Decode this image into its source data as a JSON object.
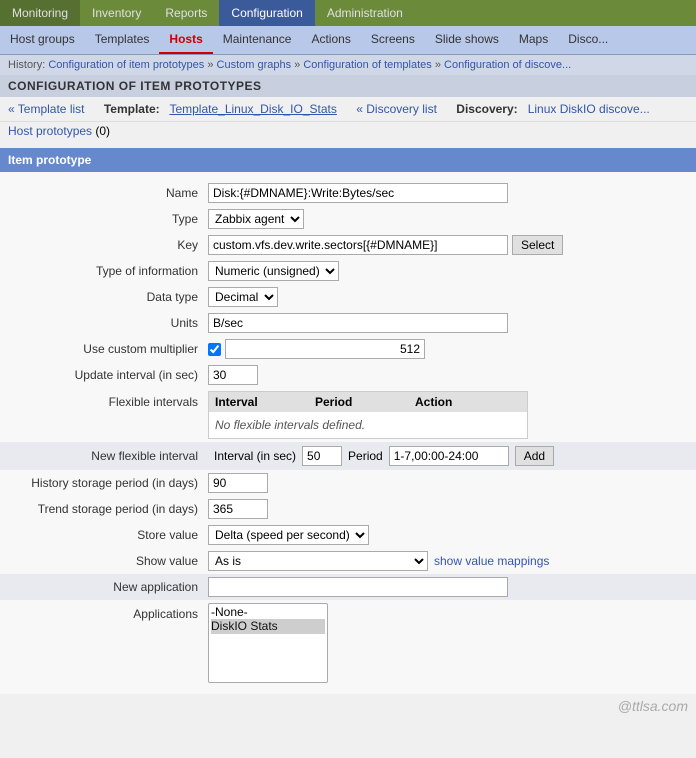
{
  "topnav": {
    "items": [
      {
        "label": "Monitoring",
        "active": false
      },
      {
        "label": "Inventory",
        "active": false
      },
      {
        "label": "Reports",
        "active": false
      },
      {
        "label": "Configuration",
        "active": true
      },
      {
        "label": "Administration",
        "active": false
      }
    ]
  },
  "secondnav": {
    "items": [
      {
        "label": "Host groups",
        "active": false
      },
      {
        "label": "Templates",
        "active": false
      },
      {
        "label": "Hosts",
        "active": true
      },
      {
        "label": "Maintenance",
        "active": false
      },
      {
        "label": "Actions",
        "active": false
      },
      {
        "label": "Screens",
        "active": false
      },
      {
        "label": "Slide shows",
        "active": false
      },
      {
        "label": "Maps",
        "active": false
      },
      {
        "label": "Disco...",
        "active": false
      }
    ]
  },
  "breadcrumb": {
    "text": "History:",
    "items": [
      {
        "label": "Configuration of item prototypes"
      },
      {
        "label": "Custom graphs"
      },
      {
        "label": "Configuration of templates"
      },
      {
        "label": "Configuration of discove..."
      }
    ]
  },
  "page_title": "CONFIGURATION OF ITEM PROTOTYPES",
  "template_line": {
    "template_list_label": "« Template list",
    "template_prefix": "Template:",
    "template_name": "Template_Linux_Disk_IO_Stats",
    "discovery_list_label": "« Discovery list",
    "discovery_prefix": "Discovery:",
    "discovery_name": "Linux DiskIO discove...",
    "host_proto_label": "Host prototypes",
    "host_proto_count": "(0)"
  },
  "section": {
    "title": "Item prototype"
  },
  "form": {
    "name_label": "Name",
    "name_value": "Disk:{#DMNAME}:Write:Bytes/sec",
    "type_label": "Type",
    "type_value": "Zabbix agent",
    "key_label": "Key",
    "key_value": "custom.vfs.dev.write.sectors[{#DMNAME}]",
    "key_btn": "Select",
    "type_info_label": "Type of information",
    "type_info_value": "Numeric (unsigned)",
    "data_type_label": "Data type",
    "data_type_value": "Decimal",
    "units_label": "Units",
    "units_value": "B/sec",
    "custom_mult_label": "Use custom multiplier",
    "custom_mult_value": "512",
    "update_interval_label": "Update interval (in sec)",
    "update_interval_value": "30",
    "flex_intervals_label": "Flexible intervals",
    "flex_table": {
      "col_interval": "Interval",
      "col_period": "Period",
      "col_action": "Action",
      "empty_msg": "No flexible intervals defined."
    },
    "new_flex_label": "New flexible interval",
    "new_flex_interval_label": "Interval (in sec)",
    "new_flex_interval_value": "50",
    "new_flex_period_label": "Period",
    "new_flex_period_value": "1-7,00:00-24:00",
    "new_flex_btn": "Add",
    "history_label": "History storage period (in days)",
    "history_value": "90",
    "trend_label": "Trend storage period (in days)",
    "trend_value": "365",
    "store_value_label": "Store value",
    "store_value_value": "Delta (speed per second)",
    "show_value_label": "Show value",
    "show_value_value": "As is",
    "show_value_link": "show value mappings",
    "new_app_label": "New application",
    "new_app_value": "",
    "apps_label": "Applications",
    "apps_options": [
      "-None-",
      "DiskIO Stats"
    ]
  },
  "watermark": "@ttlsa.com"
}
